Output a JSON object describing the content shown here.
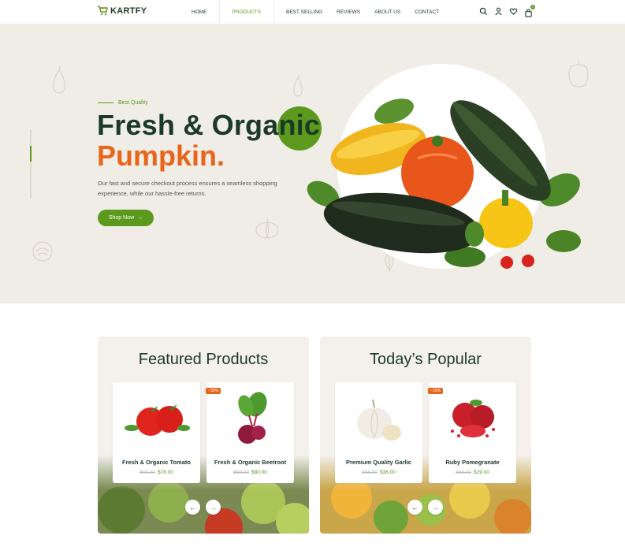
{
  "header": {
    "logo": "KARTFY",
    "nav": [
      "HOME",
      "PRODUCTS",
      "BEST SELLING",
      "REVIEWS",
      "ABOUT US",
      "CONTACT"
    ],
    "cart_count": "0"
  },
  "hero": {
    "eyebrow": "Best Quality",
    "title_line1": "Fresh & Organic",
    "title_line2": "Pumpkin.",
    "description": "Our fast and secure checkout process ensures a seamless shopping experience, while our hassle-free returns.",
    "cta": "Shop Now"
  },
  "featured": {
    "title": "Featured Products",
    "products": [
      {
        "name": "Fresh & Organic Tomato",
        "old_price": "$68.00",
        "price": "$78.00"
      },
      {
        "name": "Fresh & Organic Beetroot",
        "old_price": "$68.00",
        "price": "$80.00",
        "badge": "- 30%"
      }
    ]
  },
  "popular": {
    "title": "Today’s Popular",
    "products": [
      {
        "name": "Premium Quality Garlic",
        "old_price": "$68.00",
        "price": "$36.00"
      },
      {
        "name": "Ruby Pomegranate",
        "old_price": "$68.00",
        "price": "$29.00",
        "badge": "- 20%"
      }
    ]
  },
  "colors": {
    "primary": "#5c9a1e",
    "accent": "#e8661b",
    "dark": "#1b3a26"
  }
}
